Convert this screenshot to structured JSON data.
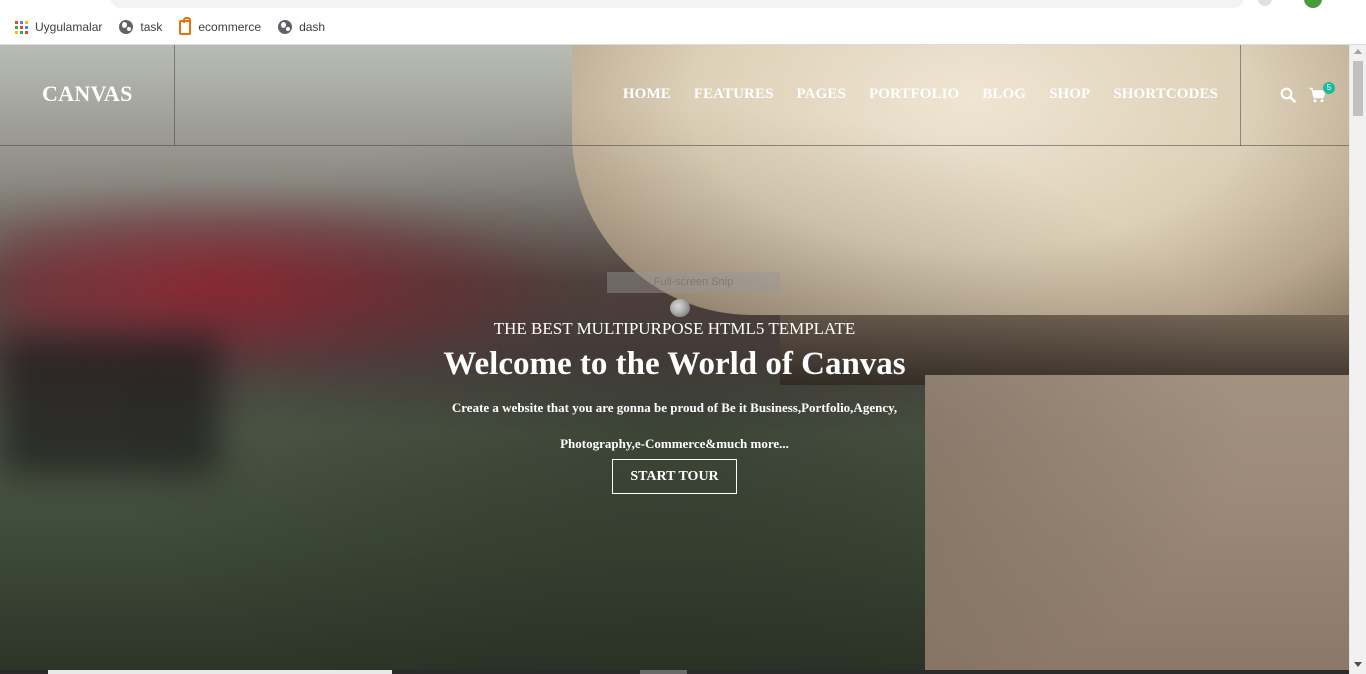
{
  "bookmarks": [
    {
      "label": "Uygulamalar",
      "icon": "apps-grid-icon"
    },
    {
      "label": "task",
      "icon": "globe-icon"
    },
    {
      "label": "ecommerce",
      "icon": "cart-favicon-icon"
    },
    {
      "label": "dash",
      "icon": "globe-icon"
    }
  ],
  "site": {
    "logo": "CANVAS",
    "nav": [
      "HOME",
      "FEATURES",
      "PAGES",
      "PORTFOLIO",
      "BLOG",
      "SHOP",
      "SHORTCODES"
    ],
    "cart_count": "5"
  },
  "hero": {
    "tooltip": "Full-screen Snip",
    "pre_title": "THE BEST MULTIPURPOSE HTML5 TEMPLATE",
    "title": "Welcome to the World of Canvas",
    "description": "Create a website that you are gonna be proud of Be it Business,Portfolio,Agency, Photography,e-Commerce&much more...",
    "cta": "START TOUR"
  },
  "colors": {
    "badge": "#1abc9c",
    "hero_text": "#ffffff"
  }
}
